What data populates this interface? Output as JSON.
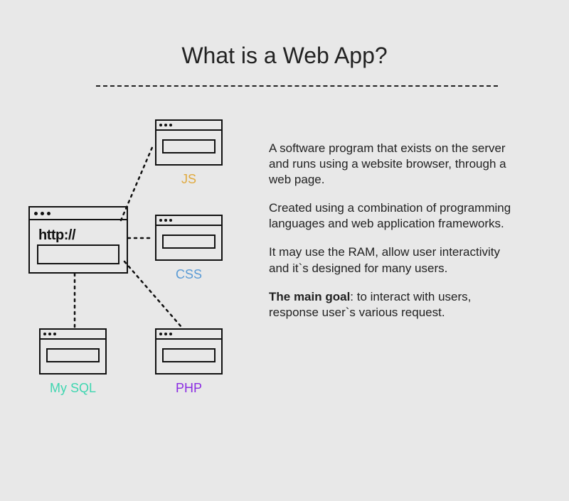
{
  "title": "What is a Web App?",
  "main_node": {
    "label": "http://"
  },
  "nodes": {
    "js": {
      "label": "JS",
      "color": "#e0a93e"
    },
    "css": {
      "label": "CSS",
      "color": "#5a9bd5"
    },
    "php": {
      "label": "PHP",
      "color": "#8a2be2"
    },
    "mysql": {
      "label": "My SQL",
      "color": "#3fd6b0"
    }
  },
  "paragraphs": {
    "p1": "A software program that exists on the server and runs using a website browser, through a web page.",
    "p2": "Created using a combination of programming languages and web application frameworks.",
    "p3": "It may use the RAM, allow user interactivity and it`s designed for many users.",
    "p4_bold": "The main goal",
    "p4_rest": ": to interact with users, response user`s various request."
  }
}
